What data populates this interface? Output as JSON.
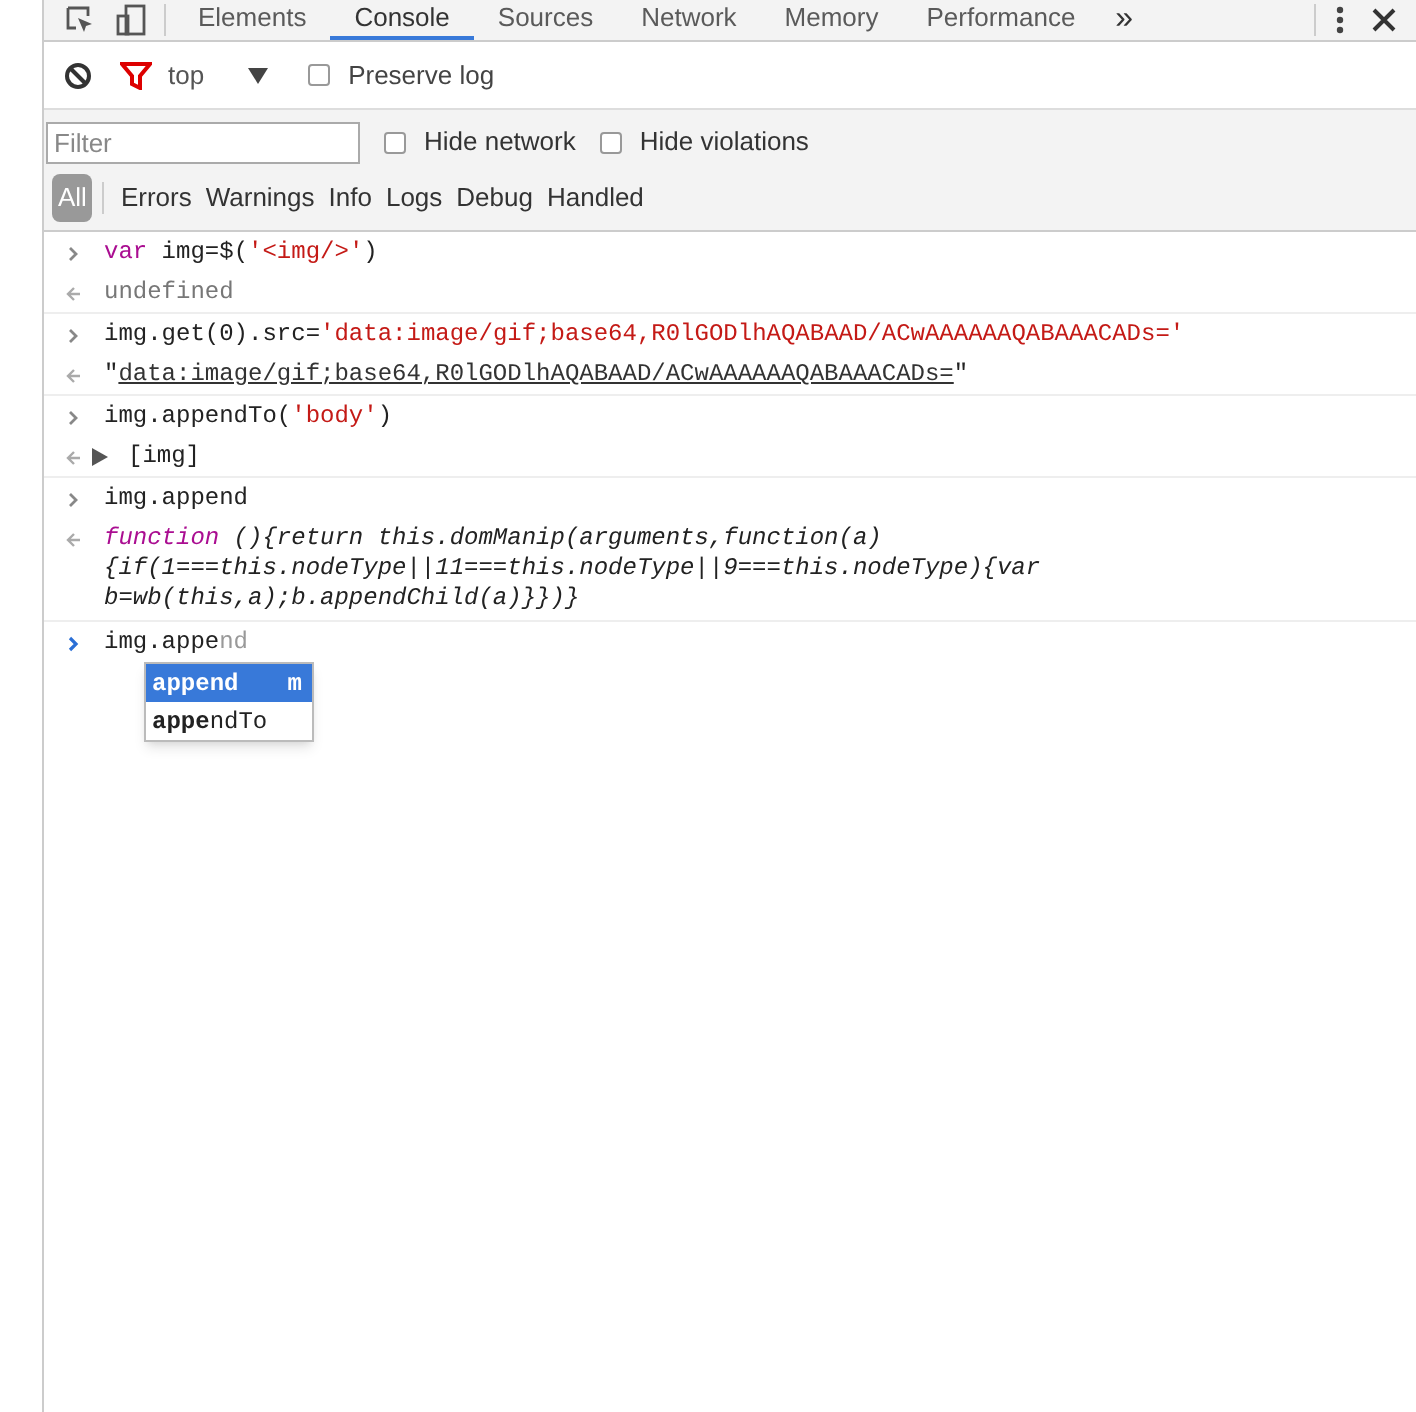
{
  "tabs": [
    {
      "label": "Elements",
      "selected": false
    },
    {
      "label": "Console",
      "selected": true
    },
    {
      "label": "Sources",
      "selected": false
    },
    {
      "label": "Network",
      "selected": false
    },
    {
      "label": "Memory",
      "selected": false
    },
    {
      "label": "Performance",
      "selected": false
    }
  ],
  "more_tabs": "»",
  "toolbar": {
    "context": "top",
    "preserve_log": {
      "label": "Preserve log",
      "checked": false
    }
  },
  "filter": {
    "placeholder": "Filter",
    "options": [
      {
        "label": "Hide network",
        "checked": false
      },
      {
        "label": "Hide violations",
        "checked": false
      }
    ]
  },
  "levels": [
    {
      "label": "All",
      "selected": true
    },
    {
      "label": "Errors",
      "selected": false
    },
    {
      "label": "Warnings",
      "selected": false
    },
    {
      "label": "Info",
      "selected": false
    },
    {
      "label": "Logs",
      "selected": false
    },
    {
      "label": "Debug",
      "selected": false
    },
    {
      "label": "Handled",
      "selected": false
    }
  ],
  "entries": [
    {
      "kind": "input",
      "segments": [
        {
          "kind": "keyword",
          "text": "var"
        },
        {
          "kind": "plain",
          "text": " img=$("
        },
        {
          "kind": "string",
          "text": "'<img/>'"
        },
        {
          "kind": "plain",
          "text": ")"
        }
      ]
    },
    {
      "kind": "output",
      "segments": [
        {
          "kind": "muted",
          "text": "undefined"
        }
      ]
    },
    {
      "kind": "input",
      "segments": [
        {
          "kind": "plain",
          "text": "img.get(0).src="
        },
        {
          "kind": "string",
          "text": "'data:image/gif;base64,R0lGODlhAQABAAD/ACwAAAAAAQABAAACADs='"
        }
      ]
    },
    {
      "kind": "output",
      "segments": [
        {
          "kind": "plain",
          "text": "\""
        },
        {
          "kind": "link",
          "text": "data:image/gif;base64,R0lGODlhAQABAAD/ACwAAAAAAQABAAACADs="
        },
        {
          "kind": "plain",
          "text": "\""
        }
      ]
    },
    {
      "kind": "input",
      "segments": [
        {
          "kind": "plain",
          "text": "img.appendTo("
        },
        {
          "kind": "string",
          "text": "'body'"
        },
        {
          "kind": "plain",
          "text": ")"
        }
      ]
    },
    {
      "kind": "output",
      "expandable": true,
      "segments": [
        {
          "kind": "plain",
          "text": "[img]"
        }
      ]
    },
    {
      "kind": "input",
      "segments": [
        {
          "kind": "plain",
          "text": "img.append"
        }
      ]
    },
    {
      "kind": "function",
      "lines": [
        "function (){return this.domManip(arguments,function(a)",
        "{if(1===this.nodeType||11===this.nodeType||9===this.nodeType){var",
        "b=wb(this,a);b.appendChild(a)}})}"
      ]
    }
  ],
  "prompt": {
    "typed": "img.appe",
    "suggestion": "nd"
  },
  "autocomplete": [
    {
      "match": "appe",
      "rest": "nd",
      "hint": "m",
      "selected": true
    },
    {
      "match": "appe",
      "rest": "ndTo",
      "selected": false
    }
  ]
}
